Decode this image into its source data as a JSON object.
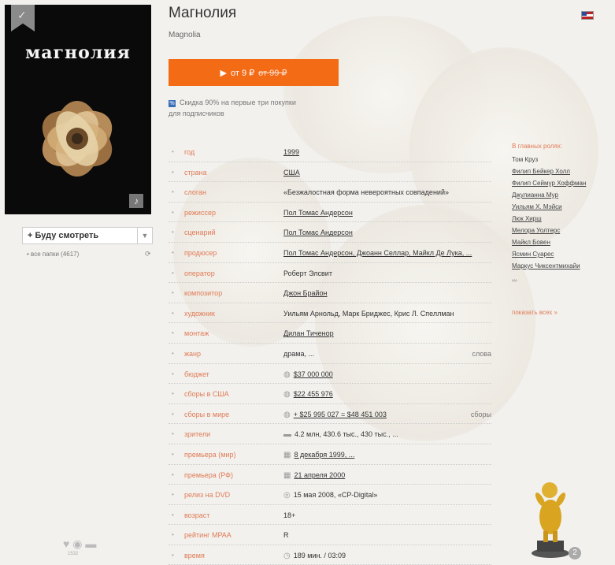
{
  "movie": {
    "title": "Магнолия",
    "original_title": "Magnolia",
    "poster_text": "магнолия"
  },
  "buy": {
    "label": "от 9 ₽",
    "old_price": "от 99 ₽"
  },
  "discount": {
    "line1": "Скидка 90% на первые три покупки",
    "line2": "для подписчиков"
  },
  "info_rows": [
    {
      "key": "год",
      "value": "1999",
      "link": true,
      "icon": ""
    },
    {
      "key": "страна",
      "value": "США",
      "link": true,
      "icon": ""
    },
    {
      "key": "слоган",
      "value": "«Безжалостная форма невероятных совпадений»",
      "link": false,
      "icon": ""
    },
    {
      "key": "режиссер",
      "value": "Пол Томас Андерсон",
      "link": true,
      "icon": ""
    },
    {
      "key": "сценарий",
      "value": "Пол Томас Андерсон",
      "link": true,
      "icon": ""
    },
    {
      "key": "продюсер",
      "value": "Пол Томас Андерсон, Джоанн Селлар, Майкл Де Лука, ...",
      "link": true,
      "icon": ""
    },
    {
      "key": "оператор",
      "value": "Роберт Элсвит",
      "link": false,
      "icon": ""
    },
    {
      "key": "композитор",
      "value": "Джон Брайон",
      "link": true,
      "icon": ""
    },
    {
      "key": "художник",
      "value": "Уильям Арнольд, Марк Бриджес, Крис Л. Спеллман",
      "link": false,
      "icon": ""
    },
    {
      "key": "монтаж",
      "value": "Дилан Тиченор",
      "link": true,
      "icon": ""
    },
    {
      "key": "жанр",
      "value": "драма, ...",
      "link": false,
      "icon": "",
      "right": "слова"
    },
    {
      "key": "бюджет",
      "value": "$37 000 000",
      "link": true,
      "icon": "coin"
    },
    {
      "key": "сборы в США",
      "value": "$22 455 976",
      "link": true,
      "icon": "coin"
    },
    {
      "key": "сборы в мире",
      "value": "+ $25 995 027 = $48 451 003",
      "link": true,
      "icon": "coin",
      "right": "сборы"
    },
    {
      "key": "зрители",
      "value": "4.2 млн,  430.6 тыс.,  430 тыс., ...",
      "link": false,
      "icon": "flags"
    },
    {
      "key": "премьера (мир)",
      "value": "8 декабря 1999, ...",
      "link": true,
      "icon": "calendar"
    },
    {
      "key": "премьера (РФ)",
      "value": "21 апреля 2000",
      "link": true,
      "icon": "calendar"
    },
    {
      "key": "релиз на DVD",
      "value": "15 мая 2008, «CP-Digital»",
      "link": false,
      "icon": "disc"
    },
    {
      "key": "возраст",
      "value": "18+",
      "link": false,
      "icon": ""
    },
    {
      "key": "рейтинг MPAA",
      "value": "R",
      "link": false,
      "icon": ""
    },
    {
      "key": "время",
      "value": "189 мин. / 03:09",
      "link": false,
      "icon": "clock"
    }
  ],
  "roles": {
    "header": "В главных ролях:",
    "actors": [
      "Том Круз",
      "Филип Бейкер Холл",
      "Филип Сеймур Хоффман",
      "Джулианна Мур",
      "Уильям Х. Мэйси",
      "Люк Хирш",
      "Мелора Уолтерс",
      "Майкл Бовен",
      "Ясмин Суарес",
      "Маркус Чиксентмихайи",
      "..."
    ],
    "show_all": "показать всех »"
  },
  "sidebar": {
    "will_watch": "Буду смотреть",
    "all_folders": "все папки (4617)",
    "social_count": "1532"
  },
  "award": {
    "count": "2"
  }
}
